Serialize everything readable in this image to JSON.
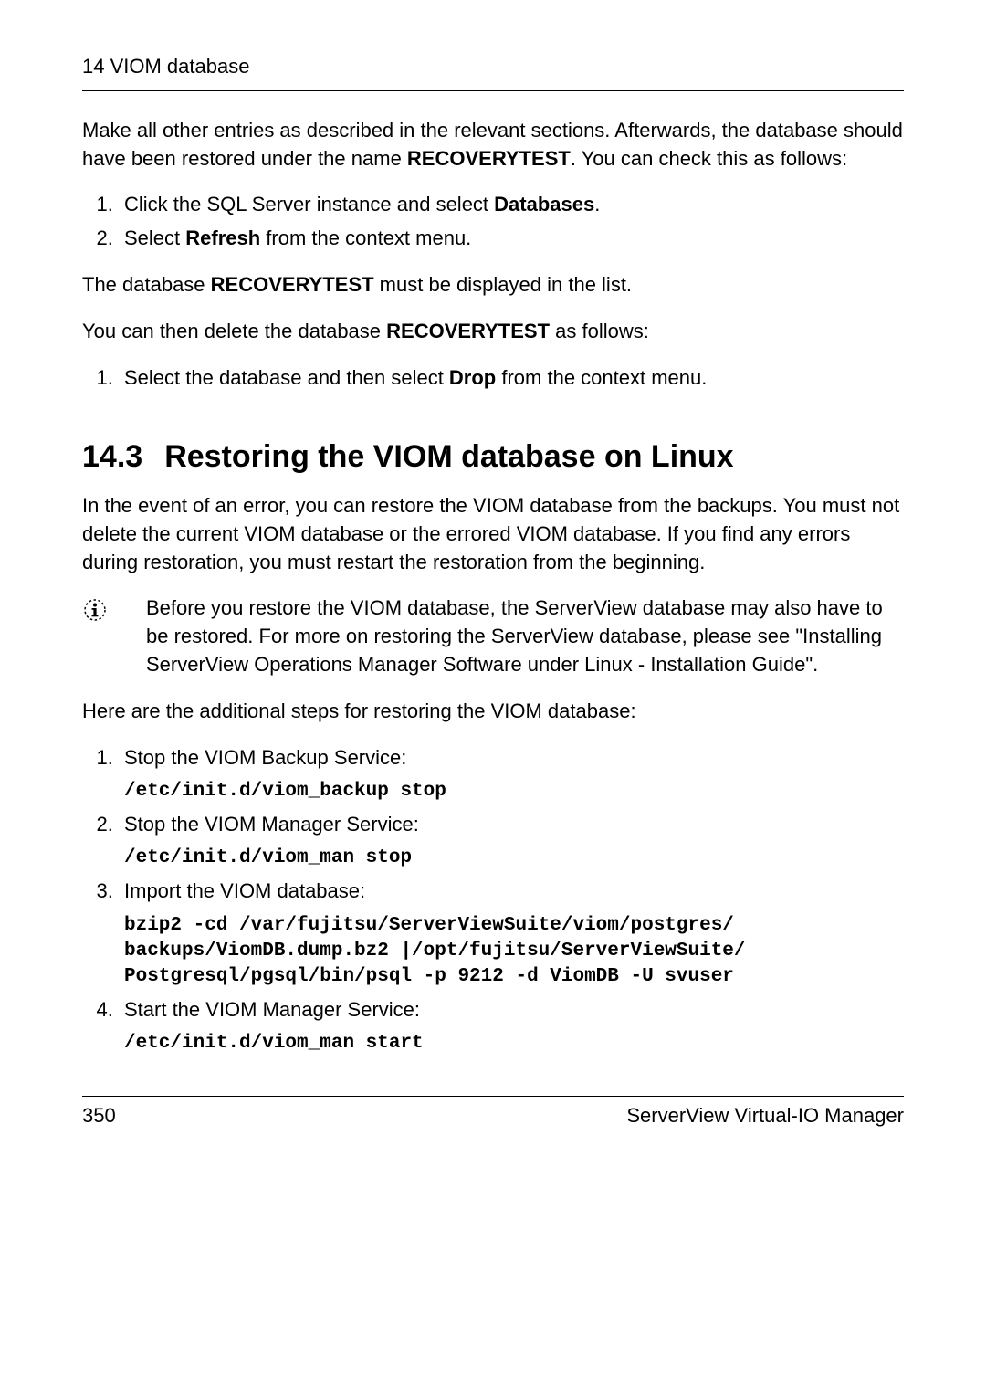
{
  "header": {
    "chapter": "14 VIOM database"
  },
  "intro": {
    "p1_a": "Make all other entries as described in the relevant sections. Afterwards, the database should have been restored under the name ",
    "p1_b": "RECOVERYTEST",
    "p1_c": ". You can check this as follows:",
    "steps1": [
      {
        "pre": "Click the SQL Server instance and select ",
        "bold": "Databases",
        "post": "."
      },
      {
        "pre": "Select ",
        "bold": "Refresh",
        "post": " from the context menu."
      }
    ],
    "p2_a": "The database ",
    "p2_b": "RECOVERYTEST",
    "p2_c": " must be displayed in the list.",
    "p3_a": "You can then delete the database ",
    "p3_b": "RECOVERYTEST",
    "p3_c": " as follows:",
    "steps2": [
      {
        "pre": "Select the database and then select ",
        "bold": "Drop",
        "post": " from the context menu."
      }
    ]
  },
  "section": {
    "number": "14.3",
    "title": "Restoring the VIOM database on Linux",
    "intro": "In the event of an error, you can restore the VIOM database from the backups. You must not delete the current VIOM database or the errored VIOM database. If you find any errors during restoration, you must restart the restoration from the beginning.",
    "note": "Before you restore the VIOM database, the ServerView database may also have to be restored. For more on restoring the ServerView database, please see \"Installing ServerView Operations Manager Software under Linux - Installation Guide\".",
    "lead": "Here are the additional steps for restoring the VIOM database:",
    "steps": [
      {
        "label": "Stop the VIOM Backup Service:",
        "code": "/etc/init.d/viom_backup stop"
      },
      {
        "label": "Stop the VIOM Manager Service:",
        "code": "/etc/init.d/viom_man stop"
      },
      {
        "label": "Import the VIOM database:",
        "code": "bzip2 -cd /var/fujitsu/ServerViewSuite/viom/postgres/\nbackups/ViomDB.dump.bz2 |/opt/fujitsu/ServerViewSuite/\nPostgresql/pgsql/bin/psql -p 9212 -d ViomDB -U svuser"
      },
      {
        "label": "Start the VIOM Manager Service:",
        "code": "/etc/init.d/viom_man start"
      }
    ]
  },
  "footer": {
    "page": "350",
    "product": "ServerView Virtual-IO Manager"
  }
}
